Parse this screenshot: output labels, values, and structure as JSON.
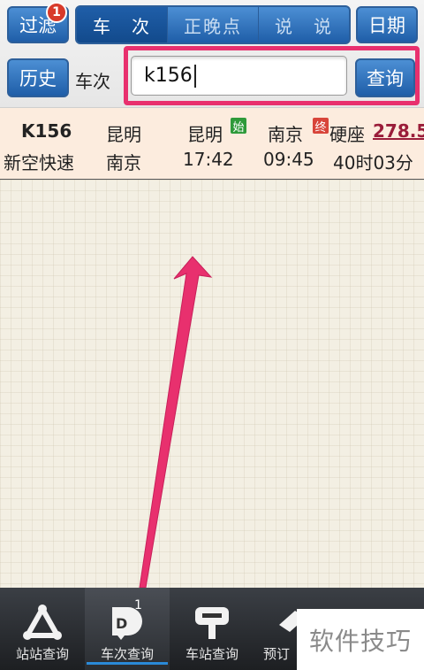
{
  "toolbar": {
    "filter_label": "过滤",
    "filter_badge": "1",
    "segments": [
      "车　次",
      "正晚点",
      "说　说"
    ],
    "active_segment": 0,
    "date_label": "日期",
    "history_label": "历史",
    "search_label": "车次",
    "search_value": "k156",
    "query_label": "查询"
  },
  "result": {
    "train_no": "K156",
    "train_type": "新空快速",
    "from_station": "昆明",
    "to_station": "南京",
    "depart_station": "昆明",
    "depart_time": "17:42",
    "start_tag": "始",
    "arrive_station": "南京",
    "arrive_time": "09:45",
    "end_tag": "终",
    "seat_type": "硬座",
    "price": "278.5",
    "duration": "40时03分"
  },
  "tabs": [
    {
      "label": "站站查询",
      "icon": "triangle-route-icon"
    },
    {
      "label": "车次查询",
      "icon": "train-number-icon",
      "badge": "1"
    },
    {
      "label": "车站查询",
      "icon": "station-sign-icon"
    },
    {
      "label": "预订",
      "icon": "ticket-icon"
    }
  ],
  "watermark": "软件技巧",
  "colors": {
    "accent": "#1f5ea8",
    "highlight": "#e8306e",
    "price": "#9a1d3a",
    "badge": "#d83a2a"
  }
}
